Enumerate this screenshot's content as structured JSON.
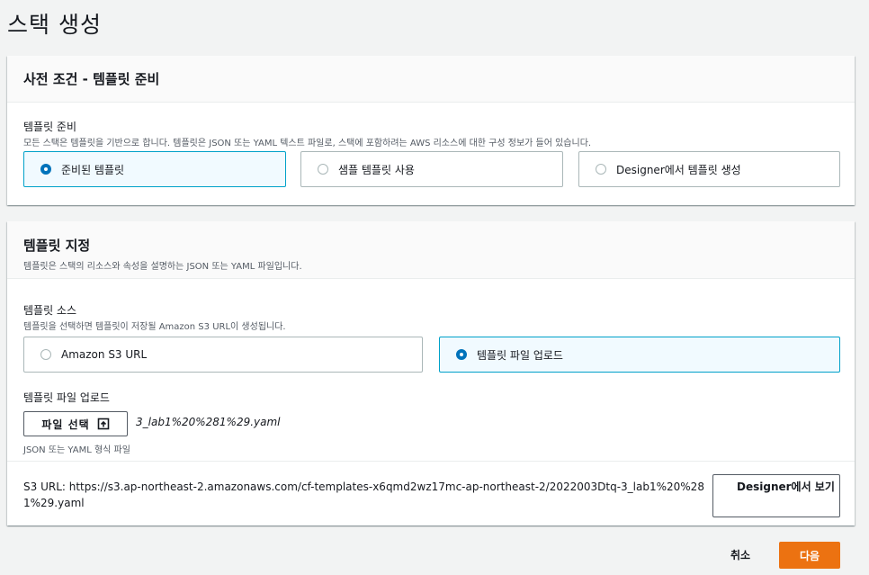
{
  "page": {
    "title": "스택 생성"
  },
  "prereq_panel": {
    "title": "사전 조건 - 템플릿 준비",
    "field_label": "템플릿 준비",
    "field_desc": "모든 스택은 템플릿을 기반으로 합니다. 템플릿은 JSON 또는 YAML 텍스트 파일로, 스택에 포함하려는 AWS 리소스에 대한 구성 정보가 들어 있습니다.",
    "options": [
      {
        "label": "준비된 템플릿",
        "selected": true
      },
      {
        "label": "샘플 템플릿 사용",
        "selected": false
      },
      {
        "label": "Designer에서 템플릿 생성",
        "selected": false
      }
    ]
  },
  "specify_panel": {
    "title": "템플릿 지정",
    "desc": "템플릿은 스택의 리소스와 속성을 설명하는 JSON 또는 YAML 파일입니다.",
    "source_label": "템플릿 소스",
    "source_desc": "템플릿을 선택하면 템플릿이 저장될 Amazon S3 URL이 생성됩니다.",
    "source_options": [
      {
        "label": "Amazon S3 URL",
        "selected": false
      },
      {
        "label": "템플릿 파일 업로드",
        "selected": true
      }
    ],
    "upload_label": "템플릿 파일 업로드",
    "choose_file_label": "파일 선택",
    "file_name": "3_lab1%20%281%29.yaml",
    "file_hint": "JSON 또는 YAML 형식 파일",
    "s3_url_text": "S3 URL:  https://s3.ap-northeast-2.amazonaws.com/cf-templates-x6qmd2wz17mc-ap-northeast-2/2022003Dtq-3_lab1%20%281%29.yaml",
    "designer_button": "Designer에서 보기"
  },
  "footer": {
    "cancel_label": "취소",
    "next_label": "다음"
  },
  "colors": {
    "accent": "#0073bb",
    "selected_border": "#00a1c9",
    "selected_bg": "#f1faff",
    "primary_button": "#ec7211"
  },
  "icons": {
    "upload": "upload-icon"
  }
}
